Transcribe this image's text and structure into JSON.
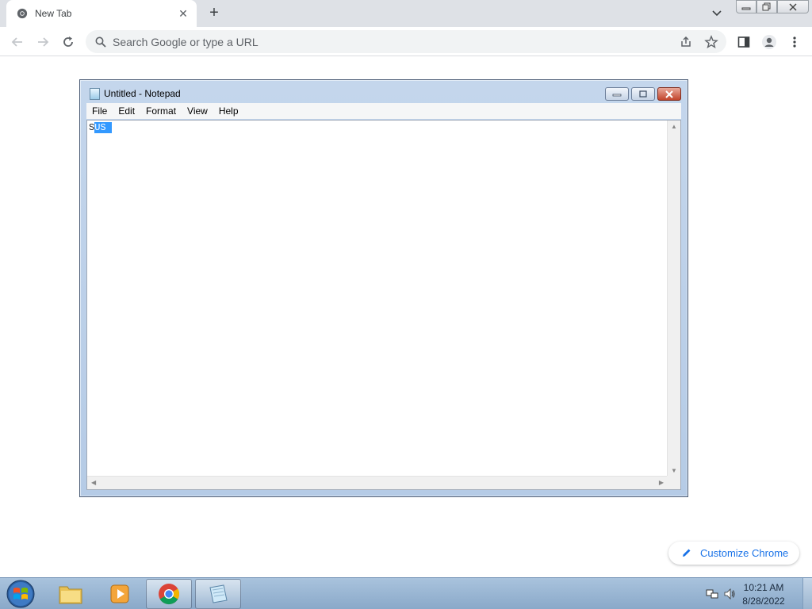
{
  "browser": {
    "tab": {
      "title": "New Tab"
    },
    "omnibox": {
      "placeholder": "Search Google or type a URL"
    },
    "customize_label": "Customize Chrome"
  },
  "notepad": {
    "title": "Untitled - Notepad",
    "menu": [
      "File",
      "Edit",
      "Format",
      "View",
      "Help"
    ],
    "content_plain": "S",
    "content_selected": "US "
  },
  "taskbar": {
    "apps": [
      "windows-explorer",
      "media-player",
      "google-chrome",
      "notepad"
    ],
    "clock_time": "10:21 AM",
    "clock_date": "8/28/2022"
  },
  "colors": {
    "chrome_frame": "#dee1e6",
    "accent_blue": "#1a73e8",
    "selection": "#3399ff"
  }
}
